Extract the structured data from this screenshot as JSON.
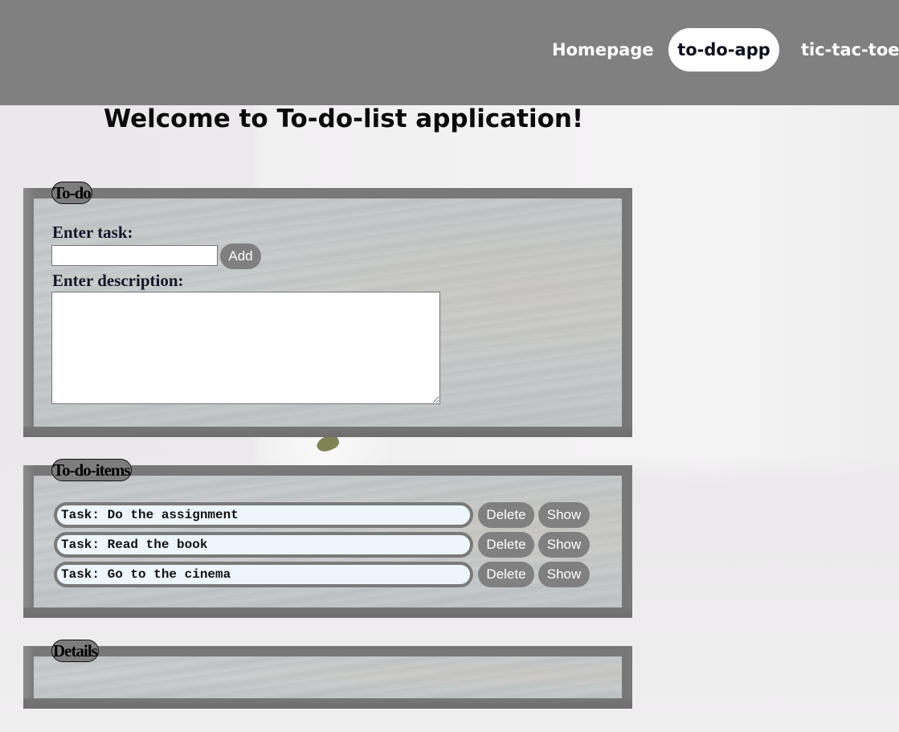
{
  "nav": {
    "links": [
      {
        "label": "Homepage"
      },
      {
        "label": "to-do-app"
      },
      {
        "label": "tic-tac-toe"
      }
    ]
  },
  "page": {
    "title": "Welcome to To-do-list application!"
  },
  "todo_form": {
    "legend": "To-do",
    "task_label": "Enter task:",
    "task_value": "",
    "add_label": "Add",
    "description_label": "Enter description:",
    "description_value": ""
  },
  "items_panel": {
    "legend": "To-do-items",
    "items": [
      {
        "text": "Task: Do the assignment",
        "delete_label": "Delete",
        "show_label": "Show"
      },
      {
        "text": "Task: Read the book",
        "delete_label": "Delete",
        "show_label": "Show"
      },
      {
        "text": "Task: Go to the cinema",
        "delete_label": "Delete",
        "show_label": "Show"
      }
    ]
  },
  "details_panel": {
    "legend": "Details"
  },
  "colors": {
    "navbar": "#808080",
    "active_tab_bg": "#ffffff",
    "button_bg": "#808080",
    "task_pill_bg": "#eef6fd"
  }
}
